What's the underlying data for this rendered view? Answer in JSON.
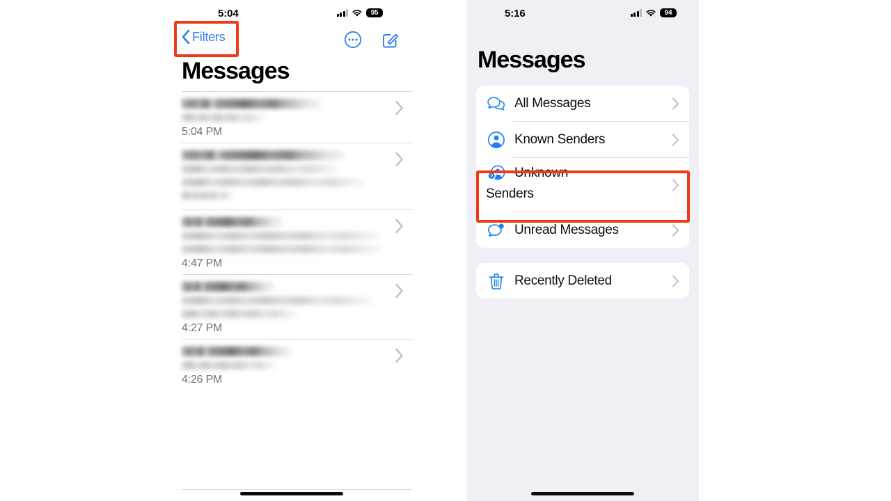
{
  "colors": {
    "accent_blue": "#2f7fe8",
    "icon_blue": "#1f80f0",
    "highlight_red": "#f03a17",
    "panel_bg": "#f0eff5",
    "card_bg": "#ffffff",
    "separator": "#dcdcdc",
    "secondary_text": "#707070",
    "chevron_gray": "#c2c2c7"
  },
  "left_phone": {
    "status_bar": {
      "time": "5:04",
      "battery": "95",
      "cellular_icon": "signal-bars-icon",
      "wifi_icon": "wifi-icon"
    },
    "nav": {
      "back_icon": "chevron-left-icon",
      "back_label": "Filters",
      "more_icon": "ellipsis-circle-icon",
      "compose_icon": "compose-square-pencil-icon"
    },
    "title": "Messages",
    "conversations": [
      {
        "lines": 2,
        "time": "5:04 PM",
        "chevron": "chevron-right-icon",
        "redacted": true
      },
      {
        "lines": 4,
        "time": "",
        "chevron": "chevron-right-icon",
        "redacted": true
      },
      {
        "lines": 3,
        "time": "4:47 PM",
        "chevron": "chevron-right-icon",
        "redacted": true
      },
      {
        "lines": 3,
        "time": "4:27 PM",
        "chevron": "chevron-right-icon",
        "redacted": true
      },
      {
        "lines": 2,
        "time": "4:26 PM",
        "chevron": "chevron-right-icon",
        "redacted": true
      }
    ],
    "home_indicator": "home-indicator"
  },
  "right_phone": {
    "status_bar": {
      "time": "5:16",
      "battery": "94",
      "cellular_icon": "signal-bars-icon",
      "wifi_icon": "wifi-icon"
    },
    "title": "Messages",
    "filter_groups": [
      {
        "items": [
          {
            "label": "All Messages",
            "icon": "two-speech-bubbles-icon",
            "chevron": "chevron-right-icon"
          },
          {
            "label": "Known Senders",
            "icon": "person-circle-icon",
            "chevron": "chevron-right-icon"
          },
          {
            "label": "Unknown Senders",
            "label_line1": "Unknown",
            "label_line2": "Senders",
            "icon": "person-question-mark-icon",
            "chevron": "chevron-right-icon",
            "highlighted": true
          },
          {
            "label": "Unread Messages",
            "icon": "speech-bubble-badge-icon",
            "chevron": "chevron-right-icon"
          }
        ]
      },
      {
        "items": [
          {
            "label": "Recently Deleted",
            "icon": "trash-icon",
            "chevron": "chevron-right-icon"
          }
        ]
      }
    ],
    "home_indicator": "home-indicator"
  },
  "annotations": [
    {
      "name": "filters-back-button-highlight",
      "shape": "rectangle",
      "color": "#f03a17"
    },
    {
      "name": "unknown-senders-row-highlight",
      "shape": "rectangle",
      "color": "#f03a17"
    }
  ]
}
